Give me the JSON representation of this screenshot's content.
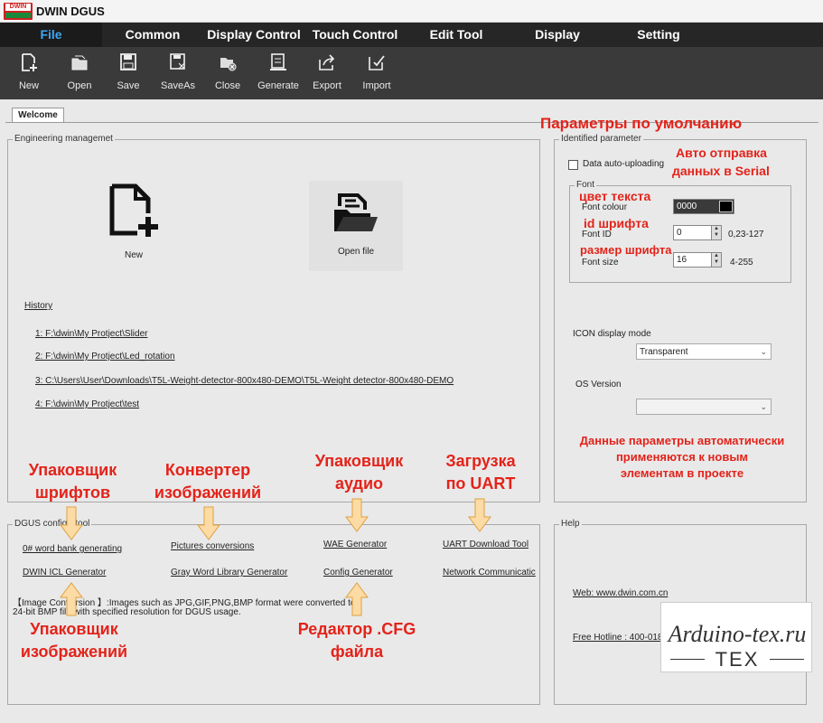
{
  "app": {
    "title": "DWIN DGUS",
    "logo_text": "DWIN"
  },
  "menu": [
    "File",
    "Common",
    "Display Control",
    "Touch Control",
    "Edit Tool",
    "Display",
    "Setting"
  ],
  "toolbar": [
    "New",
    "Open",
    "Save",
    "SaveAs",
    "Close",
    "Generate",
    "Export",
    "Import"
  ],
  "tabs": {
    "welcome": "Welcome"
  },
  "engineering": {
    "legend": "Engineering managemet",
    "new_label": "New",
    "open_label": "Open file",
    "history_label": "History",
    "history": [
      "1:  F:\\dwin\\My Protject\\Slider",
      "2:  F:\\dwin\\My Protject\\Led_rotation",
      "3:  C:\\Users\\User\\Downloads\\T5L-Weight-detector-800x480-DEMO\\T5L-Weight detector-800x480-DEMO",
      "4:  F:\\dwin\\My Protject\\test"
    ]
  },
  "identified": {
    "legend": "Identified parameter",
    "auto_upload": "Data auto-uploading",
    "font_legend": "Font",
    "font_colour_label": "Font colour",
    "font_colour_value": "0000",
    "font_colour_swatch": "#000000",
    "font_id_label": "Font ID",
    "font_id_value": "0",
    "font_id_range": "0,23-127",
    "font_size_label": "Font size",
    "font_size_value": "16",
    "font_size_range": "4-255",
    "icon_mode_label": "ICON display mode",
    "icon_mode_value": "Transparent",
    "os_version_label": "OS Version",
    "os_version_value": ""
  },
  "dgus": {
    "legend": "DGUS configurtool",
    "row1": [
      "0# word bank generating",
      "Pictures conversions",
      "WAE Generator",
      "UART Download Tool"
    ],
    "row2": [
      "DWIN ICL Generator",
      "Gray Word Library Generator",
      "Config Generator",
      "Network Communicatic"
    ],
    "note1": "【Image Conversion 】:Images such as JPG,GIF,PNG,BMP format  were converted to",
    "note2": "24-bit BMP file with specified resolution for DGUS usage."
  },
  "help": {
    "legend": "Help",
    "web": "Web: www.dwin.com.cn",
    "hotline": "Free Hotline : 400-018-9008"
  },
  "annotations": {
    "defaults": "Параметры по умолчанию",
    "auto_send": [
      "Авто отправка",
      "данных в Serial"
    ],
    "text_color": "цвет текста",
    "font_id": "id шрифта",
    "font_size": "размер шрифта",
    "params_note": [
      "Данные параметры автоматически",
      "применяются к новым",
      "элементам в проекте"
    ],
    "font_packer": [
      "Упаковщик",
      "шрифтов"
    ],
    "img_converter": [
      "Конвертер",
      "изображений"
    ],
    "audio_packer": [
      "Упаковщик",
      "аудио"
    ],
    "uart_download": [
      "Загрузка",
      "по UART"
    ],
    "img_packer": [
      "Упаковщик",
      "изображений"
    ],
    "cfg_editor": [
      "Редактор .CFG",
      "файла"
    ]
  },
  "watermark": {
    "site": "Arduino-tex.ru",
    "brand": "TEX"
  },
  "colors": {
    "annotation": "#e3231a",
    "menu_active": "#3ea6f5",
    "arrow": "#fbd9a0"
  }
}
